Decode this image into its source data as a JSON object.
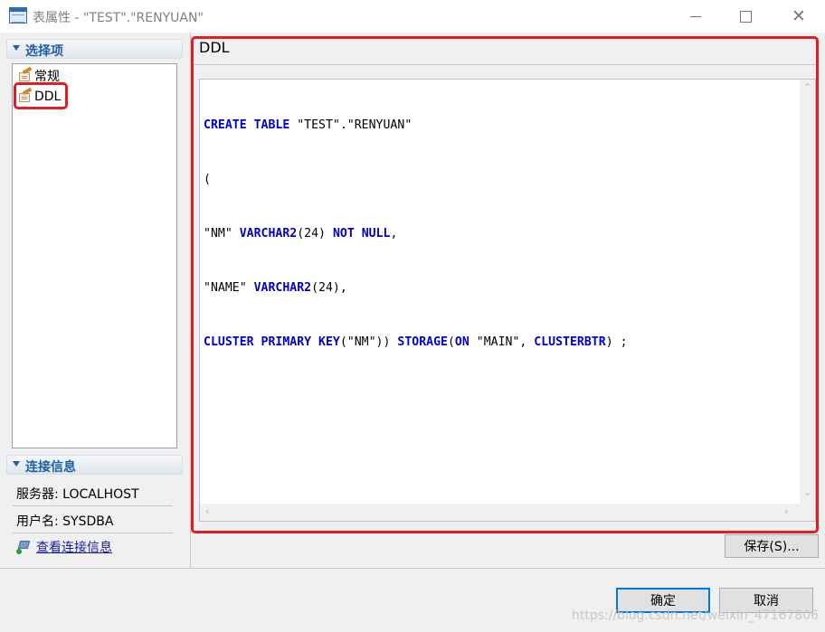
{
  "window": {
    "title": "表属性 - \"TEST\".\"RENYUAN\"",
    "icon": "table-icon",
    "controls": {
      "minimize_icon": "minimize-icon",
      "maximize_icon": "maximize-icon",
      "close_icon": "close-icon"
    }
  },
  "left_panel": {
    "options_header": "选择项",
    "tree_items": [
      {
        "label": "常规",
        "icon": "property-page-icon"
      },
      {
        "label": "DDL",
        "icon": "property-page-icon",
        "selected": true
      }
    ],
    "connection_header": "连接信息",
    "server": "服务器: LOCALHOST",
    "user": "用户名: SYSDBA",
    "view_connection_link": "查看连接信息"
  },
  "right_panel": {
    "title": "DDL",
    "code_lines": [
      "CREATE TABLE \"TEST\".\"RENYUAN\"",
      "(",
      "\"NM\" VARCHAR2(24) NOT NULL,",
      "\"NAME\" VARCHAR2(24),",
      "CLUSTER PRIMARY KEY(\"NM\")) STORAGE(ON \"MAIN\", CLUSTERBTR) ;"
    ],
    "save_button": "保存(S)..."
  },
  "footer": {
    "ok_button": "确定",
    "cancel_button": "取消",
    "watermark": "https://blog.csdn.net/weixin_47167806"
  },
  "colors": {
    "keyword": "#0000cc",
    "highlight_box": "#e02020",
    "section_header_text": "#1f5fa8",
    "link": "#1a1a9a",
    "primary_button_border": "#0078d7"
  }
}
